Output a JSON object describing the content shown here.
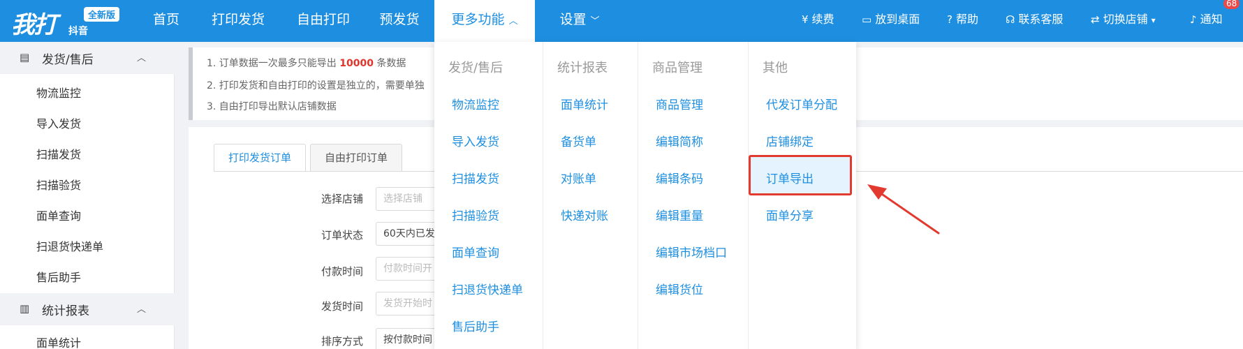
{
  "topbar": {
    "logo": {
      "main": "我打",
      "badge": "全新版",
      "sub": "抖音"
    },
    "nav": [
      {
        "label": "首页"
      },
      {
        "label": "打印发货"
      },
      {
        "label": "自由打印"
      },
      {
        "label": "预发货"
      },
      {
        "label": "更多功能",
        "chevron": "^"
      },
      {
        "label": "设置",
        "chevron": "v"
      }
    ],
    "tools": [
      {
        "icon": "yen-circle-icon",
        "label": "续费"
      },
      {
        "icon": "monitor-icon",
        "label": "放到桌面"
      },
      {
        "icon": "question-icon",
        "label": "帮助"
      },
      {
        "icon": "headset-icon",
        "label": "联系客服"
      },
      {
        "icon": "switch-icon",
        "label": "切换店铺"
      },
      {
        "icon": "bell-icon",
        "label": "通知"
      }
    ],
    "notification_count": "68",
    "accent_color": "#1e8fe0"
  },
  "sidebar": {
    "groups": [
      {
        "label": "发货/售后",
        "icon": "truck-icon",
        "items": [
          "物流监控",
          "导入发货",
          "扫描发货",
          "扫描验货",
          "面单查询",
          "扫退货快递单",
          "售后助手"
        ]
      },
      {
        "label": "统计报表",
        "icon": "bar-chart-icon",
        "items": [
          "面单统计"
        ]
      }
    ]
  },
  "notice": {
    "line1_a": "1. 订单数据一次最多只能导出",
    "line1_num": "10000",
    "line1_b": "条数据",
    "line2": "2. 打印发货和自由打印的设置是独立的，需要单独",
    "line3": "3. 自由打印导出默认店铺数据"
  },
  "tabs": [
    "打印发货订单",
    "自由打印订单"
  ],
  "form": {
    "fields": [
      {
        "label": "选择店铺",
        "value": "",
        "placeholder": "选择店铺"
      },
      {
        "label": "订单状态",
        "value": "60天内已发",
        "placeholder": ""
      },
      {
        "label": "付款时间",
        "value": "",
        "placeholder": "付款时间开"
      },
      {
        "label": "发货时间",
        "value": "",
        "placeholder": "发货开始时"
      },
      {
        "label": "排序方式",
        "value": "按付款时间",
        "placeholder": ""
      }
    ]
  },
  "dropdown": {
    "columns": [
      {
        "heading": "发货/售后",
        "items": [
          "物流监控",
          "导入发货",
          "扫描发货",
          "扫描验货",
          "面单查询",
          "扫退货快递单",
          "售后助手"
        ]
      },
      {
        "heading": "统计报表",
        "items": [
          "面单统计",
          "备货单",
          "对账单",
          "快递对账"
        ]
      },
      {
        "heading": "商品管理",
        "items": [
          "商品管理",
          "编辑简称",
          "编辑条码",
          "编辑重量",
          "编辑市场档口",
          "编辑货位"
        ]
      },
      {
        "heading": "其他",
        "items": [
          "代发订单分配",
          "店铺绑定",
          "订单导出",
          "面单分享"
        ]
      }
    ],
    "highlighted_item": "订单导出",
    "highlight_color": "#e23a2f"
  }
}
